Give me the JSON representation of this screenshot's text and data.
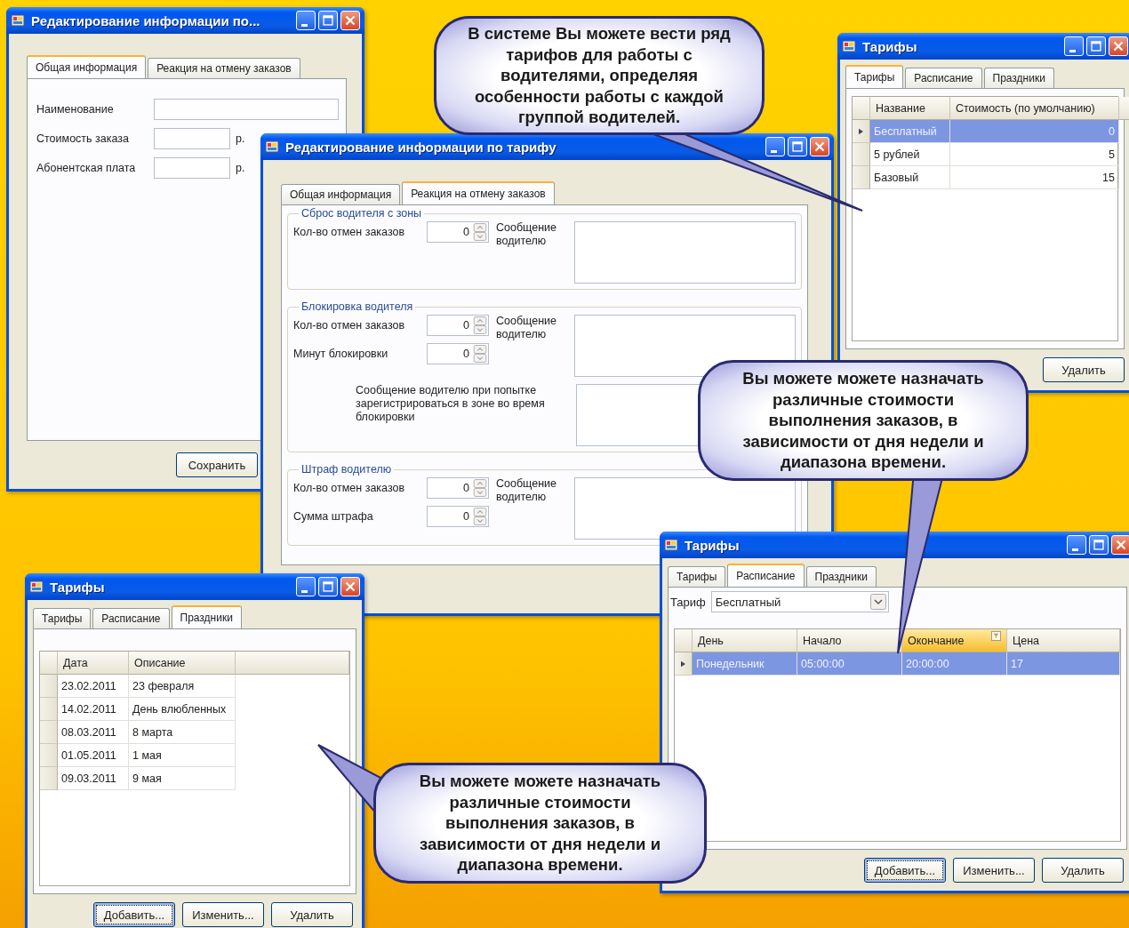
{
  "windows": [
    {
      "kind": "form",
      "title": "Редактирование информации по...",
      "tabs": [
        {
          "label": "Общая информация",
          "selected": true
        },
        {
          "label": "Реакция на отмену заказов",
          "selected": false
        }
      ],
      "fields": [
        {
          "label": "Наименование"
        },
        {
          "label": "Стоимость заказа",
          "unit": "р."
        },
        {
          "label": "Абонентская плата",
          "unit": "р."
        }
      ],
      "buttons": [
        {
          "label": "Сохранить",
          "focused": false
        }
      ]
    },
    {
      "kind": "reaction",
      "title": "Редактирование информации по тарифу",
      "tabs": [
        {
          "label": "Общая информация",
          "selected": false
        },
        {
          "label": "Реакция на отмену заказов",
          "selected": true
        }
      ],
      "groups": [
        {
          "title": "Сброс водителя с зоны",
          "spinners": [
            {
              "label": "Кол-во отмен заказов",
              "value": "0"
            }
          ],
          "messages": [
            {
              "label": "Сообщение водителю"
            }
          ]
        },
        {
          "title": "Блокировка водителя",
          "spinners": [
            {
              "label": "Кол-во отмен заказов",
              "value": "0"
            },
            {
              "label": "Минут блокировки",
              "value": "0"
            }
          ],
          "messages": [
            {
              "label": "Сообщение водителю"
            },
            {
              "label": "Сообщение водителю при попытке зарегистрироваться в зоне во время блокировки"
            }
          ]
        },
        {
          "title": "Штраф водителю",
          "spinners": [
            {
              "label": "Кол-во отмен заказов",
              "value": "0"
            },
            {
              "label": "Сумма штрафа",
              "value": "0"
            }
          ],
          "messages": [
            {
              "label": "Сообщение водителю"
            }
          ]
        }
      ]
    },
    {
      "kind": "grid",
      "title": "Тарифы",
      "tabs": [
        {
          "label": "Тарифы",
          "selected": true
        },
        {
          "label": "Расписание",
          "selected": false
        },
        {
          "label": "Праздники",
          "selected": false
        }
      ],
      "grid": {
        "columns": [
          {
            "label": "Название"
          },
          {
            "label": "Стоимость (по умолчанию)"
          }
        ],
        "rows": [
          {
            "cells": [
              "Бесплатный",
              "0"
            ],
            "selected": true
          },
          {
            "cells": [
              "5 рублей",
              "5"
            ],
            "selected": false
          },
          {
            "cells": [
              "Базовый",
              "15"
            ],
            "selected": false
          }
        ]
      },
      "buttons": [
        {
          "label": "Удалить",
          "focused": false
        }
      ]
    },
    {
      "kind": "grid",
      "title": "Тарифы",
      "tabs": [
        {
          "label": "Тарифы",
          "selected": false
        },
        {
          "label": "Расписание",
          "selected": false
        },
        {
          "label": "Праздники",
          "selected": true
        }
      ],
      "grid": {
        "columns": [
          {
            "label": "Дата"
          },
          {
            "label": "Описание"
          }
        ],
        "rows": [
          {
            "cells": [
              "23.02.2011",
              "23 февраля"
            ],
            "selected": false
          },
          {
            "cells": [
              "14.02.2011",
              "День влюбленных"
            ],
            "selected": false
          },
          {
            "cells": [
              "08.03.2011",
              "8 марта"
            ],
            "selected": false
          },
          {
            "cells": [
              "01.05.2011",
              "1 мая"
            ],
            "selected": false
          },
          {
            "cells": [
              "09.03.2011",
              "9 мая"
            ],
            "selected": false
          }
        ]
      },
      "buttons": [
        {
          "label": "Добавить...",
          "focused": true
        },
        {
          "label": "Изменить...",
          "focused": false
        },
        {
          "label": "Удалить",
          "focused": false
        }
      ]
    },
    {
      "kind": "grid",
      "title": "Тарифы",
      "tabs": [
        {
          "label": "Тарифы",
          "selected": false
        },
        {
          "label": "Расписание",
          "selected": true
        },
        {
          "label": "Праздники",
          "selected": false
        }
      ],
      "filter": {
        "label": "Тариф",
        "value": "Бесплатный"
      },
      "grid": {
        "columns": [
          {
            "label": "День",
            "filtered": false
          },
          {
            "label": "Начало",
            "filtered": false
          },
          {
            "label": "Окончание",
            "filtered": true
          },
          {
            "label": "Цена",
            "filtered": false
          }
        ],
        "rows": [
          {
            "cells": [
              "Понедельник",
              "05:00:00",
              "20:00:00",
              "17"
            ],
            "selected": true
          }
        ]
      },
      "buttons": [
        {
          "label": "Добавить...",
          "focused": true
        },
        {
          "label": "Изменить...",
          "focused": false
        },
        {
          "label": "Удалить",
          "focused": false
        }
      ]
    }
  ],
  "callouts": [
    {
      "text": "В системе Вы можете вести ряд тарифов для работы с водителями, определяя особенности работы с каждой группой водителей."
    },
    {
      "text": "Вы можете можете назначать различные стоимости выполнения заказов, в зависимости от дня недели и диапазона времени."
    },
    {
      "text": "Вы можете можете назначать различные стоимости выполнения заказов, в зависимости от дня недели и диапазона времени."
    }
  ]
}
